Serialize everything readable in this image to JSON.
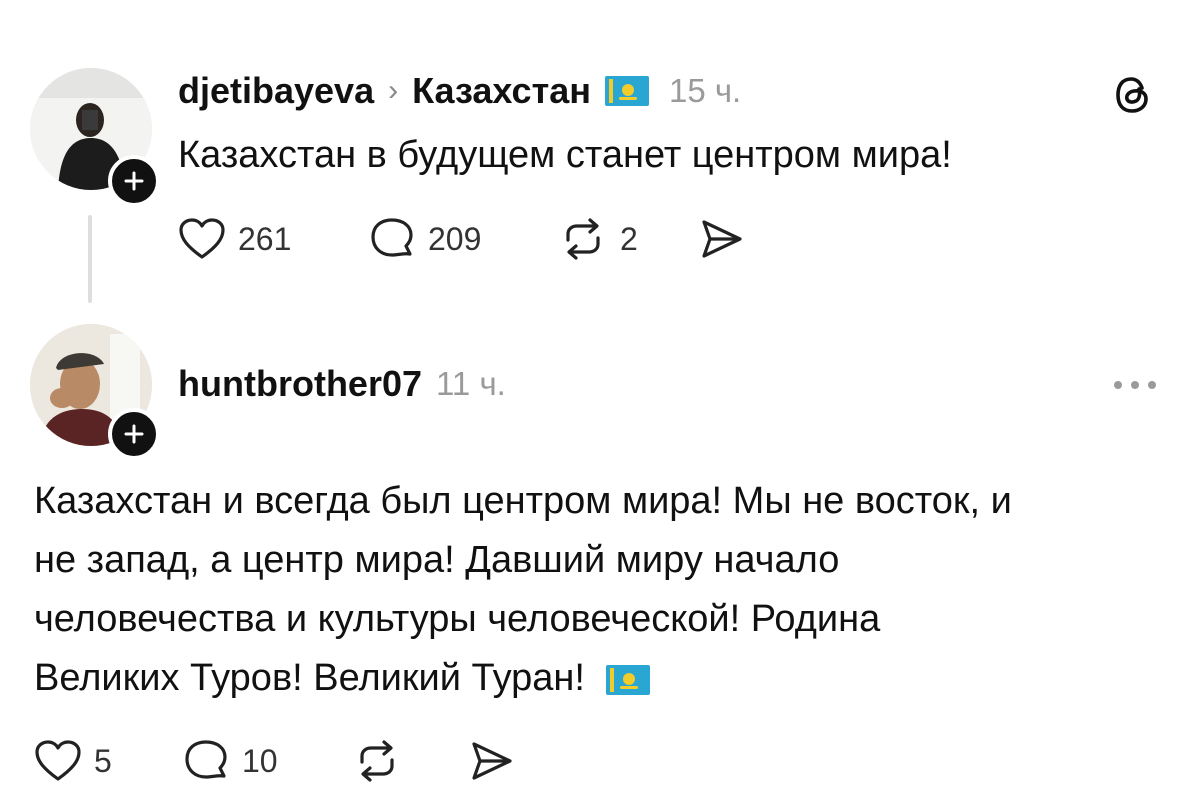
{
  "posts": [
    {
      "username": "djetibayeva",
      "separator": "›",
      "community": "Казахстан",
      "time": "15 ч.",
      "text": "Казахстан в будущем станет центром мира!",
      "likes": "261",
      "comments": "209",
      "reposts": "2"
    },
    {
      "username": "huntbrother07",
      "time": "11 ч.",
      "text_lines": [
        "Казахстан и всегда был центром мира! Мы не восток, и",
        "не запад, а центр мира! Давший миру начало",
        "человечества и культуры человеческой! Родина",
        "Великих Туров! Великий Туран!"
      ],
      "likes": "5",
      "comments": "10"
    }
  ],
  "icons": {
    "threads": "threads-logo-icon",
    "like": "heart-icon",
    "comment": "comment-bubble-icon",
    "repost": "repost-icon",
    "share": "share-send-icon",
    "more": "more-dots-icon",
    "follow": "plus-icon",
    "flag": "kazakhstan-flag-icon"
  },
  "colors": {
    "text": "#111111",
    "muted": "#9a9a9a",
    "flag_blue": "#2aa6d3",
    "flag_gold": "#f1cc2b"
  }
}
